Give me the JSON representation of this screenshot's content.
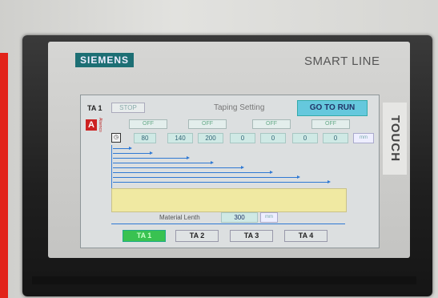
{
  "device": {
    "brand": "SIEMENS",
    "model": "SMART LINE",
    "side_label": "TOUCH"
  },
  "screen": {
    "header": {
      "ta_label": "TA 1",
      "stop_label": "STOP",
      "title": "Taping Setting",
      "go_to_run_label": "GO TO RUN"
    },
    "logo": {
      "letter": "A",
      "text": "Alsenco"
    },
    "off_buttons": [
      "OFF",
      "OFF",
      "OFF",
      "OFF"
    ],
    "values": [
      "80",
      "140",
      "200",
      "0",
      "0",
      "0",
      "0"
    ],
    "unit": "mm",
    "material_length": {
      "label": "Material Lenth",
      "value": "300",
      "unit": "mm"
    },
    "tabs": [
      "TA 1",
      "TA 2",
      "TA 3",
      "TA 4"
    ],
    "active_tab_index": 0,
    "colors": {
      "accent": "#65c8dd",
      "active_tab": "#39c251",
      "message_box": "#f0e9a2"
    }
  }
}
